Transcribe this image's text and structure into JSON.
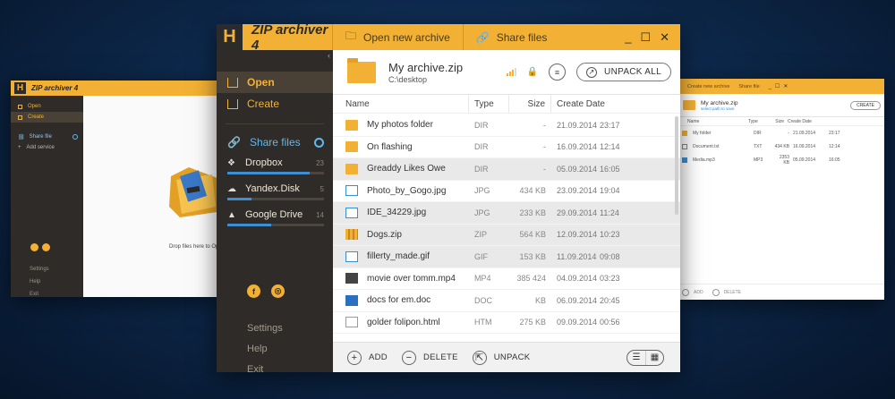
{
  "left_window": {
    "logo": "H",
    "app_title": "ZIP archiver 4",
    "nav": [
      {
        "label": "Open"
      },
      {
        "label": "Create"
      }
    ],
    "share_label": "Share file",
    "add_service": "Add service",
    "bottom_links": [
      "Settings",
      "Help",
      "Exit"
    ],
    "drop_text": "Drop files here to Ope"
  },
  "main_window": {
    "logo": "H",
    "app_title": "ZIP archiver 4",
    "top_buttons": [
      {
        "label": "Open new archive",
        "icon": "folder-icon"
      },
      {
        "label": "Share files",
        "icon": "link-icon"
      }
    ],
    "window_controls": {
      "minimize": "_",
      "maximize": "☐",
      "close": "✕"
    },
    "sidebar": {
      "nav": [
        {
          "label": "Open",
          "active": true
        },
        {
          "label": "Create",
          "active": false
        }
      ],
      "share_label": "Share files",
      "services": [
        {
          "name": "Dropbox",
          "count": "23",
          "fill": 0.85
        },
        {
          "name": "Yandex.Disk",
          "count": "5",
          "fill": 0.25
        },
        {
          "name": "Google Drive",
          "count": "14",
          "fill": 0.45
        }
      ],
      "bottom_links": [
        "Settings",
        "Help",
        "Exit"
      ]
    },
    "archive": {
      "name": "My archive.zip",
      "path": "C:\\desktop",
      "unpack_all": "UNPACK ALL"
    },
    "columns": {
      "name": "Name",
      "type": "Type",
      "size": "Size",
      "date": "Create Date"
    },
    "files": [
      {
        "name": "My photos folder",
        "type": "DIR",
        "size": "-",
        "date": "21.09.2014",
        "time": "23:17",
        "icon": "folder"
      },
      {
        "name": "On flashing",
        "type": "DIR",
        "size": "-",
        "date": "16.09.2014",
        "time": "12:14",
        "icon": "folder"
      },
      {
        "name": "Greaddy Likes Owe",
        "type": "DIR",
        "size": "-",
        "date": "05.09.2014",
        "time": "16:05",
        "icon": "folder",
        "selected": true
      },
      {
        "name": "Photo_by_Gogo.jpg",
        "type": "JPG",
        "size": "434 KB",
        "date": "23.09.2014",
        "time": "19:04",
        "icon": "img"
      },
      {
        "name": "IDE_34229.jpg",
        "type": "JPG",
        "size": "233 KB",
        "date": "29.09.2014",
        "time": "11:24",
        "icon": "img",
        "selected": true
      },
      {
        "name": "Dogs.zip",
        "type": "ZIP",
        "size": "564 KB",
        "date": "12.09.2014",
        "time": "10:23",
        "icon": "zip",
        "selected": true
      },
      {
        "name": "fillerty_made.gif",
        "type": "GIF",
        "size": "153 KB",
        "date": "11.09.2014",
        "time": "09:08",
        "icon": "img",
        "selected": true
      },
      {
        "name": "movie over tomm.mp4",
        "type": "MP4",
        "size": "385 424",
        "date": "04.09.2014",
        "time": "03:23",
        "icon": "video"
      },
      {
        "name": "docs for em.doc",
        "type": "DOC",
        "size": "KB",
        "date": "06.09.2014",
        "time": "20:45",
        "icon": "doc"
      },
      {
        "name": "golder folipon.html",
        "type": "HTM",
        "size": "275 KB",
        "date": "09.09.2014",
        "time": "00:56",
        "icon": "html"
      }
    ],
    "footer": {
      "add": "ADD",
      "delete": "DELETE",
      "unpack": "UNPACK"
    }
  },
  "right_window": {
    "top_buttons": [
      "Create new archive",
      "Share file"
    ],
    "archive_name": "My archive.zip",
    "archive_path": "select path to save",
    "create_button": "CREATE",
    "columns": {
      "name": "Name",
      "type": "Type",
      "size": "Size",
      "date": "Create Date"
    },
    "files": [
      {
        "name": "My folder",
        "type": "DIR",
        "size": "-",
        "date": "21.09.2014",
        "time": "23:17"
      },
      {
        "name": "Document.txt",
        "type": "TXT",
        "size": "434 KB",
        "date": "16.09.2014",
        "time": "12:14"
      },
      {
        "name": "Media.mp3",
        "type": "MP3",
        "size": "2353 KB",
        "date": "05.09.2014",
        "time": "16:05"
      }
    ],
    "footer": {
      "add": "ADD",
      "delete": "DELETE"
    }
  },
  "colors": {
    "accent": "#f2b134",
    "sidebar_bg": "#2e2b28",
    "share_blue": "#62b8ea",
    "bar_blue": "#3d8fd2"
  }
}
